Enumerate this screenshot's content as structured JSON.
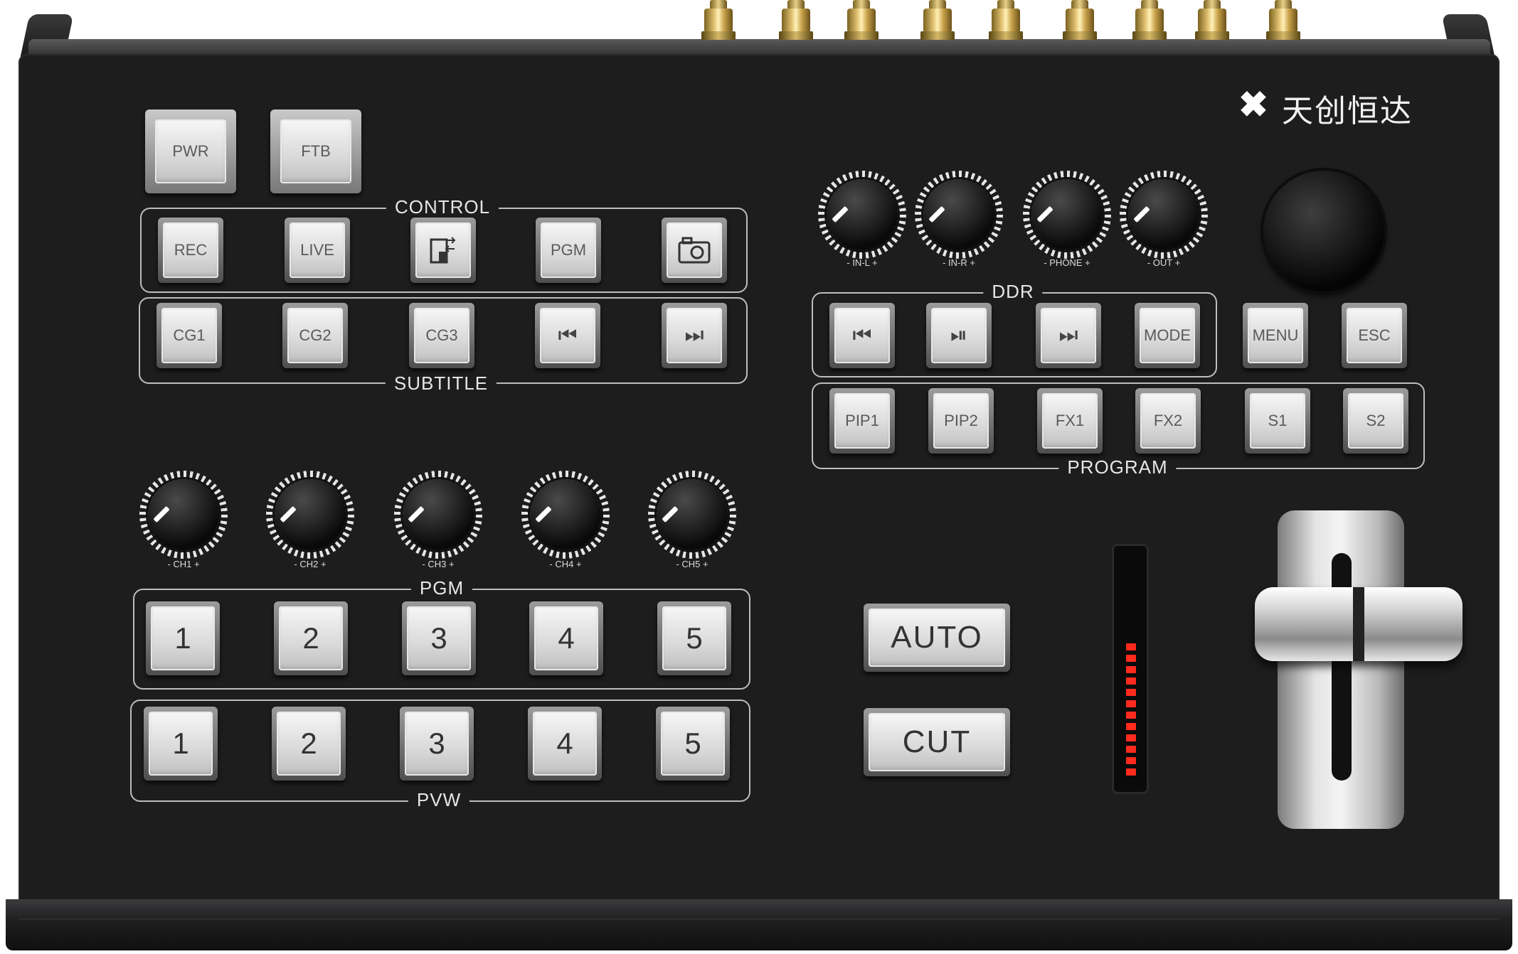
{
  "brand": {
    "logo_text": "天创恒达"
  },
  "power": {
    "pwr": "PWR",
    "ftb": "FTB"
  },
  "control": {
    "label": "CONTROL",
    "keys": [
      "REC",
      "LIVE",
      "",
      "PGM",
      ""
    ],
    "icons": [
      "",
      "",
      "layout-swap-icon",
      "",
      "camera-icon"
    ]
  },
  "subtitle": {
    "label": "SUBTITLE",
    "keys": [
      "CG1",
      "CG2",
      "CG3",
      "",
      ""
    ],
    "icons": [
      "",
      "",
      "",
      "skip-previous-icon",
      "skip-next-icon"
    ]
  },
  "audio_monitor": {
    "knobs": [
      "- IN-L +",
      "- IN-R +",
      "- PHONE +",
      "- OUT +"
    ]
  },
  "ddr": {
    "label": "DDR",
    "keys": [
      "",
      "",
      "",
      "MODE"
    ],
    "icons": [
      "skip-previous-icon",
      "play-pause-icon",
      "skip-next-icon",
      ""
    ]
  },
  "menu": {
    "menu": "MENU",
    "esc": "ESC"
  },
  "program": {
    "label": "PROGRAM",
    "keys": [
      "PIP1",
      "PIP2",
      "FX1",
      "FX2",
      "S1",
      "S2"
    ]
  },
  "channels": {
    "knobs": [
      "- CH1 +",
      "- CH2 +",
      "- CH3 +",
      "- CH4 +",
      "- CH5 +"
    ]
  },
  "pgm_bus": {
    "label": "PGM",
    "keys": [
      "1",
      "2",
      "3",
      "4",
      "5"
    ]
  },
  "pvw_bus": {
    "label": "PVW",
    "keys": [
      "1",
      "2",
      "3",
      "4",
      "5"
    ]
  },
  "transition": {
    "auto": "AUTO",
    "cut": "CUT"
  },
  "colors": {
    "panel": "#1d1d1e",
    "meter_led": "#ff2a1e",
    "connector": "#d6b967"
  }
}
